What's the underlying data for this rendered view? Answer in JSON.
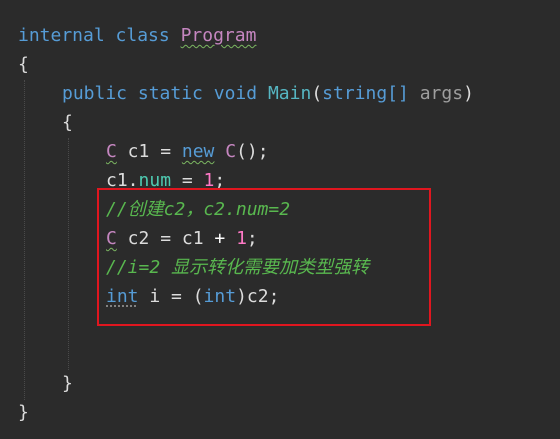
{
  "code": {
    "line1": {
      "kw": "internal",
      "kw2": "class",
      "name": "Program"
    },
    "line2": {
      "brace": "{"
    },
    "line3": {
      "kw": "public",
      "kw2": "static",
      "kw3": "void",
      "method": "Main",
      "open": "(",
      "type": "string[]",
      "param": "args",
      "close": ")"
    },
    "line4": {
      "brace": "{"
    },
    "line5": {
      "type": "C",
      "rest": " c1 = ",
      "kw": "new",
      "ctor": "C",
      "end": "();"
    },
    "line6": {
      "obj": "c1.",
      "field": "num",
      "eq": " = ",
      "num": "1",
      "end": ";"
    },
    "line7": {
      "comment": "//创建c2，c2.num=2"
    },
    "line8": {
      "type": "C",
      "rest": " c2 = c1 ",
      "op": "+",
      "num": "1",
      "end": ";"
    },
    "line9": {
      "comment": "//i=2 显示转化需要加类型强转"
    },
    "line10": {
      "kw": "int",
      "var": " i = (",
      "cast": "int",
      "end": ")c2;"
    },
    "line13": {
      "brace": "}"
    },
    "line14": {
      "brace": "}"
    }
  },
  "colors": {
    "background": "#2b2b2b",
    "keyword": "#569cd6",
    "type": "#c586c0",
    "method": "#56b6c2",
    "comment": "#59b84f",
    "number": "#ff79c6",
    "highlight_border": "#e0161f"
  }
}
